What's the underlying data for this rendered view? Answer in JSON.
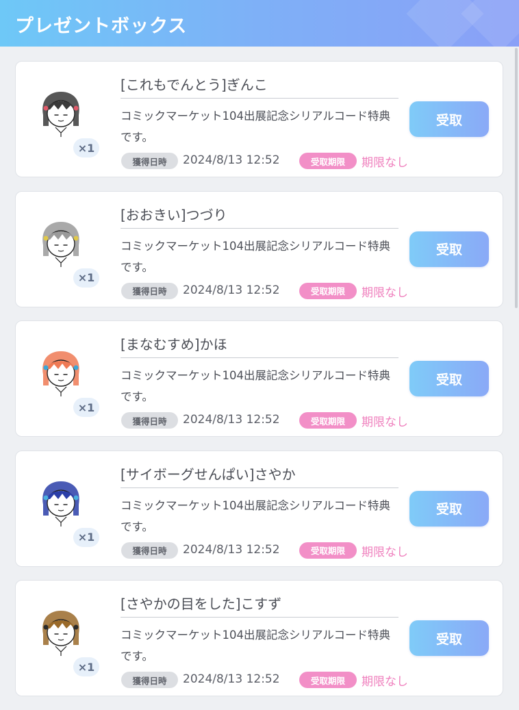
{
  "header": {
    "title": "プレゼントボックス"
  },
  "labels": {
    "acquired_tag": "獲得日時",
    "deadline_tag": "受取期限",
    "receive_button": "受取"
  },
  "colors": {
    "header_gradient_start": "#6ec8f7",
    "header_gradient_end": "#8aa0f7",
    "deadline_pink": "#f28fc7",
    "button_gradient_start": "#7fcbf8",
    "button_gradient_end": "#8aa9f7"
  },
  "items": [
    {
      "title": "[これもでんとう]ぎんこ",
      "description": "コミックマーケット104出展記念シリアルコード特典です。",
      "quantity": "×1",
      "acquired_at": "2024/8/13 12:52",
      "deadline": "期限なし",
      "avatar": {
        "icon": "character-avatar-icon",
        "hair": "#3a3a3a",
        "accent": "#e05a6a"
      }
    },
    {
      "title": "[おおきい]つづり",
      "description": "コミックマーケット104出展記念シリアルコード特典です。",
      "quantity": "×1",
      "acquired_at": "2024/8/13 12:52",
      "deadline": "期限なし",
      "avatar": {
        "icon": "character-avatar-icon",
        "hair": "#9a9a9a",
        "accent": "#e0c84a"
      }
    },
    {
      "title": "[まなむすめ]かほ",
      "description": "コミックマーケット104出展記念シリアルコード特典です。",
      "quantity": "×1",
      "acquired_at": "2024/8/13 12:52",
      "deadline": "期限なし",
      "avatar": {
        "icon": "character-avatar-icon",
        "hair": "#ef7a55",
        "accent": "#3aa6d8"
      }
    },
    {
      "title": "[サイボーグせんぱい]さやか",
      "description": "コミックマーケット104出展記念シリアルコード特典です。",
      "quantity": "×1",
      "acquired_at": "2024/8/13 12:52",
      "deadline": "期限なし",
      "avatar": {
        "icon": "character-avatar-icon",
        "hair": "#2a3ea8",
        "accent": "#4ab0e0"
      }
    },
    {
      "title": "[さやかの目をした]こすず",
      "description": "コミックマーケット104出展記念シリアルコード特典です。",
      "quantity": "×1",
      "acquired_at": "2024/8/13 12:52",
      "deadline": "期限なし",
      "avatar": {
        "icon": "character-avatar-icon",
        "hair": "#9a6a2a",
        "accent": "#2a2a2a"
      }
    }
  ]
}
